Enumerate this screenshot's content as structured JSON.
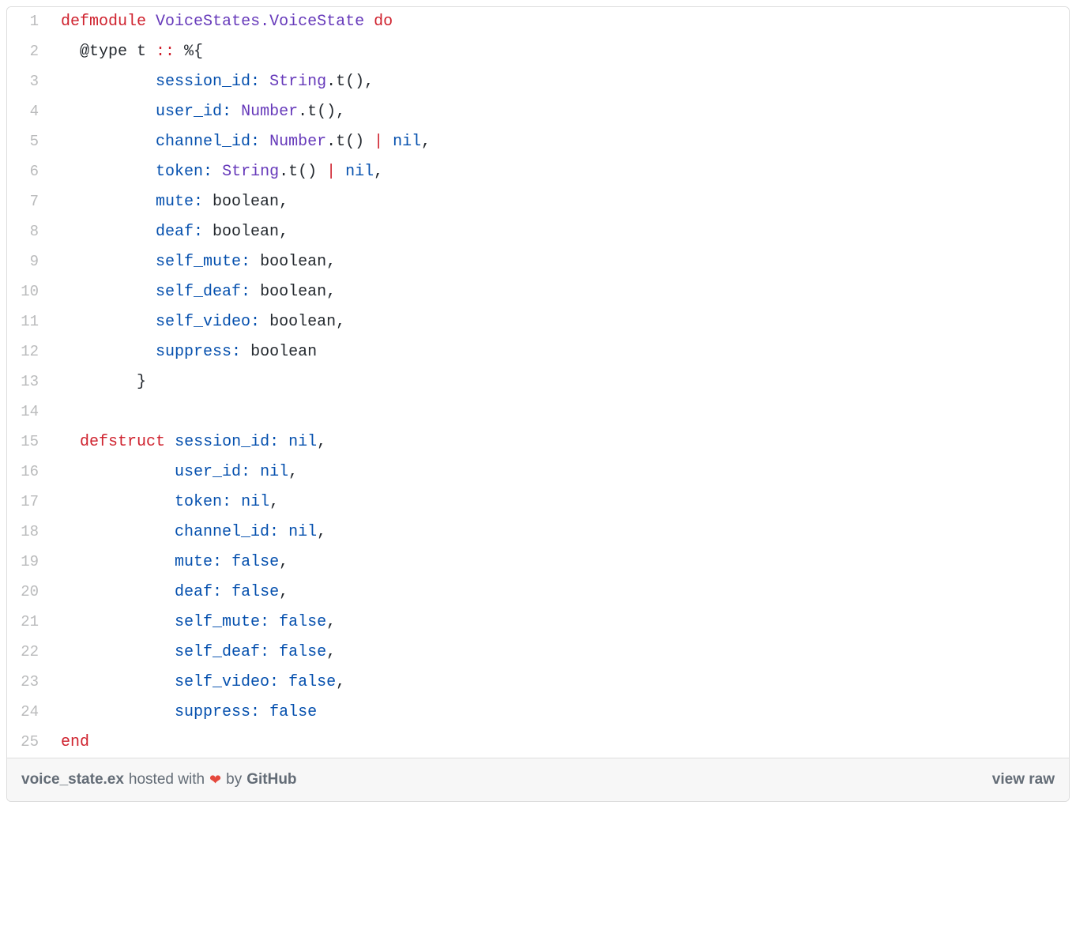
{
  "footer": {
    "filename": "voice_state.ex",
    "hosted_with": "hosted with",
    "by": "by",
    "github": "GitHub",
    "view_raw": "view raw"
  },
  "lines": [
    {
      "num": "1",
      "tokens": [
        {
          "cls": "kw-red",
          "text": "defmodule"
        },
        {
          "cls": "text-default",
          "text": " "
        },
        {
          "cls": "kw-purple",
          "text": "VoiceStates.VoiceState"
        },
        {
          "cls": "text-default",
          "text": " "
        },
        {
          "cls": "kw-red",
          "text": "do"
        }
      ]
    },
    {
      "num": "2",
      "tokens": [
        {
          "cls": "text-default",
          "text": "  @type t "
        },
        {
          "cls": "kw-red",
          "text": "::"
        },
        {
          "cls": "text-default",
          "text": " %{"
        }
      ]
    },
    {
      "num": "3",
      "tokens": [
        {
          "cls": "text-default",
          "text": "          "
        },
        {
          "cls": "kw-blue",
          "text": "session_id:"
        },
        {
          "cls": "text-default",
          "text": " "
        },
        {
          "cls": "kw-purple",
          "text": "String"
        },
        {
          "cls": "text-default",
          "text": ".t(),"
        }
      ]
    },
    {
      "num": "4",
      "tokens": [
        {
          "cls": "text-default",
          "text": "          "
        },
        {
          "cls": "kw-blue",
          "text": "user_id:"
        },
        {
          "cls": "text-default",
          "text": " "
        },
        {
          "cls": "kw-purple",
          "text": "Number"
        },
        {
          "cls": "text-default",
          "text": ".t(),"
        }
      ]
    },
    {
      "num": "5",
      "tokens": [
        {
          "cls": "text-default",
          "text": "          "
        },
        {
          "cls": "kw-blue",
          "text": "channel_id:"
        },
        {
          "cls": "text-default",
          "text": " "
        },
        {
          "cls": "kw-purple",
          "text": "Number"
        },
        {
          "cls": "text-default",
          "text": ".t() "
        },
        {
          "cls": "kw-red",
          "text": "|"
        },
        {
          "cls": "text-default",
          "text": " "
        },
        {
          "cls": "kw-blue",
          "text": "nil"
        },
        {
          "cls": "text-default",
          "text": ","
        }
      ]
    },
    {
      "num": "6",
      "tokens": [
        {
          "cls": "text-default",
          "text": "          "
        },
        {
          "cls": "kw-blue",
          "text": "token:"
        },
        {
          "cls": "text-default",
          "text": " "
        },
        {
          "cls": "kw-purple",
          "text": "String"
        },
        {
          "cls": "text-default",
          "text": ".t() "
        },
        {
          "cls": "kw-red",
          "text": "|"
        },
        {
          "cls": "text-default",
          "text": " "
        },
        {
          "cls": "kw-blue",
          "text": "nil"
        },
        {
          "cls": "text-default",
          "text": ","
        }
      ]
    },
    {
      "num": "7",
      "tokens": [
        {
          "cls": "text-default",
          "text": "          "
        },
        {
          "cls": "kw-blue",
          "text": "mute:"
        },
        {
          "cls": "text-default",
          "text": " boolean,"
        }
      ]
    },
    {
      "num": "8",
      "tokens": [
        {
          "cls": "text-default",
          "text": "          "
        },
        {
          "cls": "kw-blue",
          "text": "deaf:"
        },
        {
          "cls": "text-default",
          "text": " boolean,"
        }
      ]
    },
    {
      "num": "9",
      "tokens": [
        {
          "cls": "text-default",
          "text": "          "
        },
        {
          "cls": "kw-blue",
          "text": "self_mute:"
        },
        {
          "cls": "text-default",
          "text": " boolean,"
        }
      ]
    },
    {
      "num": "10",
      "tokens": [
        {
          "cls": "text-default",
          "text": "          "
        },
        {
          "cls": "kw-blue",
          "text": "self_deaf:"
        },
        {
          "cls": "text-default",
          "text": " boolean,"
        }
      ]
    },
    {
      "num": "11",
      "tokens": [
        {
          "cls": "text-default",
          "text": "          "
        },
        {
          "cls": "kw-blue",
          "text": "self_video:"
        },
        {
          "cls": "text-default",
          "text": " boolean,"
        }
      ]
    },
    {
      "num": "12",
      "tokens": [
        {
          "cls": "text-default",
          "text": "          "
        },
        {
          "cls": "kw-blue",
          "text": "suppress:"
        },
        {
          "cls": "text-default",
          "text": " boolean"
        }
      ]
    },
    {
      "num": "13",
      "tokens": [
        {
          "cls": "text-default",
          "text": "        }"
        }
      ]
    },
    {
      "num": "14",
      "tokens": []
    },
    {
      "num": "15",
      "tokens": [
        {
          "cls": "text-default",
          "text": "  "
        },
        {
          "cls": "kw-red",
          "text": "defstruct"
        },
        {
          "cls": "text-default",
          "text": " "
        },
        {
          "cls": "kw-blue",
          "text": "session_id:"
        },
        {
          "cls": "text-default",
          "text": " "
        },
        {
          "cls": "kw-blue",
          "text": "nil"
        },
        {
          "cls": "text-default",
          "text": ","
        }
      ]
    },
    {
      "num": "16",
      "tokens": [
        {
          "cls": "text-default",
          "text": "            "
        },
        {
          "cls": "kw-blue",
          "text": "user_id:"
        },
        {
          "cls": "text-default",
          "text": " "
        },
        {
          "cls": "kw-blue",
          "text": "nil"
        },
        {
          "cls": "text-default",
          "text": ","
        }
      ]
    },
    {
      "num": "17",
      "tokens": [
        {
          "cls": "text-default",
          "text": "            "
        },
        {
          "cls": "kw-blue",
          "text": "token:"
        },
        {
          "cls": "text-default",
          "text": " "
        },
        {
          "cls": "kw-blue",
          "text": "nil"
        },
        {
          "cls": "text-default",
          "text": ","
        }
      ]
    },
    {
      "num": "18",
      "tokens": [
        {
          "cls": "text-default",
          "text": "            "
        },
        {
          "cls": "kw-blue",
          "text": "channel_id:"
        },
        {
          "cls": "text-default",
          "text": " "
        },
        {
          "cls": "kw-blue",
          "text": "nil"
        },
        {
          "cls": "text-default",
          "text": ","
        }
      ]
    },
    {
      "num": "19",
      "tokens": [
        {
          "cls": "text-default",
          "text": "            "
        },
        {
          "cls": "kw-blue",
          "text": "mute:"
        },
        {
          "cls": "text-default",
          "text": " "
        },
        {
          "cls": "kw-blue",
          "text": "false"
        },
        {
          "cls": "text-default",
          "text": ","
        }
      ]
    },
    {
      "num": "20",
      "tokens": [
        {
          "cls": "text-default",
          "text": "            "
        },
        {
          "cls": "kw-blue",
          "text": "deaf:"
        },
        {
          "cls": "text-default",
          "text": " "
        },
        {
          "cls": "kw-blue",
          "text": "false"
        },
        {
          "cls": "text-default",
          "text": ","
        }
      ]
    },
    {
      "num": "21",
      "tokens": [
        {
          "cls": "text-default",
          "text": "            "
        },
        {
          "cls": "kw-blue",
          "text": "self_mute:"
        },
        {
          "cls": "text-default",
          "text": " "
        },
        {
          "cls": "kw-blue",
          "text": "false"
        },
        {
          "cls": "text-default",
          "text": ","
        }
      ]
    },
    {
      "num": "22",
      "tokens": [
        {
          "cls": "text-default",
          "text": "            "
        },
        {
          "cls": "kw-blue",
          "text": "self_deaf:"
        },
        {
          "cls": "text-default",
          "text": " "
        },
        {
          "cls": "kw-blue",
          "text": "false"
        },
        {
          "cls": "text-default",
          "text": ","
        }
      ]
    },
    {
      "num": "23",
      "tokens": [
        {
          "cls": "text-default",
          "text": "            "
        },
        {
          "cls": "kw-blue",
          "text": "self_video:"
        },
        {
          "cls": "text-default",
          "text": " "
        },
        {
          "cls": "kw-blue",
          "text": "false"
        },
        {
          "cls": "text-default",
          "text": ","
        }
      ]
    },
    {
      "num": "24",
      "tokens": [
        {
          "cls": "text-default",
          "text": "            "
        },
        {
          "cls": "kw-blue",
          "text": "suppress:"
        },
        {
          "cls": "text-default",
          "text": " "
        },
        {
          "cls": "kw-blue",
          "text": "false"
        }
      ]
    },
    {
      "num": "25",
      "tokens": [
        {
          "cls": "kw-red",
          "text": "end"
        }
      ]
    }
  ]
}
